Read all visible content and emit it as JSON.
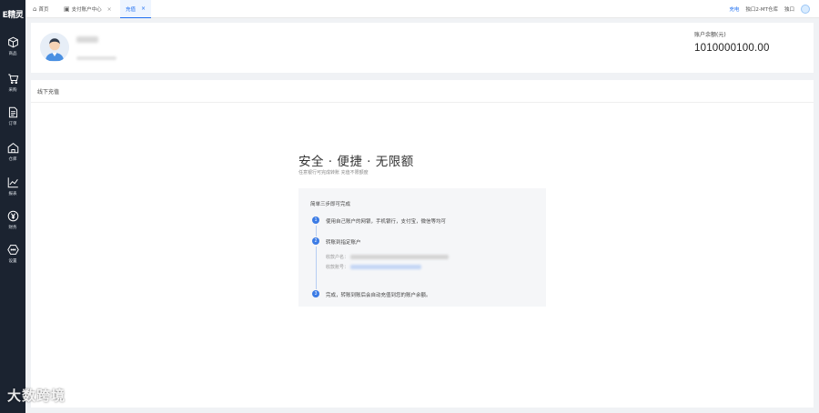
{
  "app": {
    "logo_text": "E精灵"
  },
  "sidebar": {
    "items": [
      {
        "label": "商品",
        "icon": "cube-icon"
      },
      {
        "label": "采购",
        "icon": "cart-icon"
      },
      {
        "label": "订单",
        "icon": "document-icon"
      },
      {
        "label": "仓库",
        "icon": "warehouse-icon"
      },
      {
        "label": "报表",
        "icon": "chart-icon"
      },
      {
        "label": "财务",
        "icon": "yen-icon"
      },
      {
        "label": "设置",
        "icon": "settings-icon"
      }
    ]
  },
  "tabs": [
    {
      "label": "首页",
      "icon": "home-icon"
    },
    {
      "label": "支付账户中心",
      "icon": "account-card-icon"
    },
    {
      "label": "充值",
      "active": true
    }
  ],
  "topbar": {
    "link": "充电",
    "shop": "独口2-MT仓库",
    "user": "独口"
  },
  "account": {
    "balance_label": "账户余额(元)",
    "balance_value": "1010000100.00"
  },
  "recharge": {
    "section_title": "线下充值",
    "hero_title": "安全 · 便捷 · 无限额",
    "hero_subtitle": "任意银行可完成转账 充值不限额度",
    "steps_heading": "简单三步即可完成",
    "steps": [
      {
        "num": "1",
        "text": "使用自己账户的网银，手机银行，支付宝，微信等均可"
      },
      {
        "num": "2",
        "text": "转账到指定账户"
      },
      {
        "num": "3",
        "text": "完成，转账到账后会自动充值到您的账户余额。"
      }
    ],
    "detail_labels": {
      "payee_name": "收款户名：",
      "payee_account": "收款账号："
    }
  },
  "watermark": "大数跨境",
  "colors": {
    "sidebar_bg": "#1b2330",
    "accent": "#1f6ff1",
    "step_blue": "#3b7be5"
  }
}
